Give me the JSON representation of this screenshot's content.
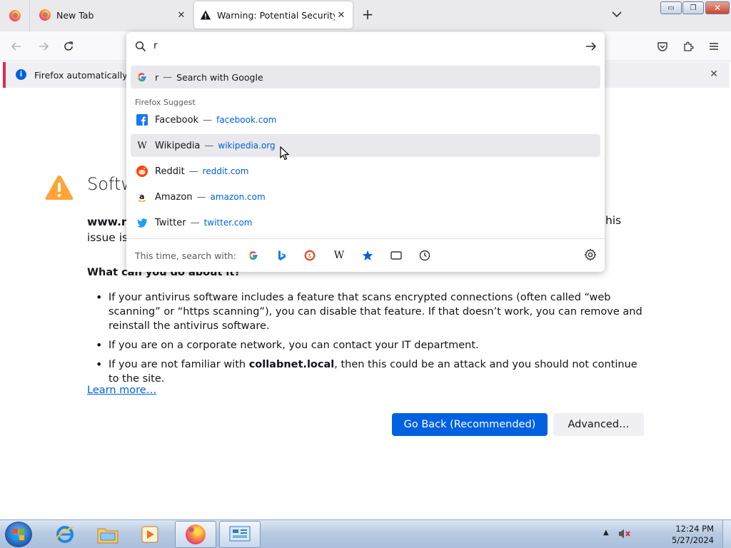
{
  "window": {
    "controls": {
      "minimize": "▭",
      "maximize": "❐",
      "close": "✕"
    }
  },
  "tabs": [
    {
      "title": "New Tab",
      "icon": "firefox-icon"
    },
    {
      "title": "Warning: Potential Security Risk",
      "icon": "warning-icon",
      "active": true
    }
  ],
  "tabbar": {
    "new_tab": "+",
    "close_glyph": "✕"
  },
  "notification": {
    "text": "Firefox automatically sen",
    "close": "✕"
  },
  "urlbar": {
    "input_value": "r",
    "top_suggestion": {
      "term": "r",
      "action": "Search with Google"
    },
    "group_label": "Firefox Suggest",
    "suggestions": [
      {
        "title": "Facebook",
        "url": "facebook.com",
        "icon": "facebook-icon"
      },
      {
        "title": "Wikipedia",
        "url": "wikipedia.org",
        "icon": "wikipedia-icon"
      },
      {
        "title": "Reddit",
        "url": "reddit.com",
        "icon": "reddit-icon"
      },
      {
        "title": "Amazon",
        "url": "amazon.com",
        "icon": "amazon-icon"
      },
      {
        "title": "Twitter",
        "url": "twitter.com",
        "icon": "twitter-icon"
      }
    ],
    "dash": "—",
    "oneoff_label": "This time, search with:",
    "oneoff_engines": [
      "google-icon",
      "bing-icon",
      "duckduckgo-icon",
      "wikipedia-icon",
      "bookmarks-icon",
      "tabs-icon",
      "history-icon"
    ]
  },
  "error_page": {
    "title": "Softw",
    "intro_host": "www.n",
    "intro_line2": "issue is",
    "intro_tail": "his",
    "heading": "What can you do about it?",
    "bullets": [
      {
        "text": "If your antivirus software includes a feature that scans encrypted connections (often called “web scanning” or “https scanning”), you can disable that feature. If that doesn’t work, you can remove and reinstall the antivirus software."
      },
      {
        "text": "If you are on a corporate network, you can contact your IT department."
      },
      {
        "pre": "If you are not familiar with ",
        "bold": "collabnet.local",
        "post": ", then this could be an attack and you should not continue to the site."
      }
    ],
    "learn_more": "Learn more…",
    "go_back_button": "Go Back (Recommended)",
    "advanced_button": "Advanced…"
  },
  "taskbar": {
    "time": "12:24 PM",
    "date": "5/27/2024",
    "tray_arrow": "▲"
  },
  "colors": {
    "accent": "#0061e0",
    "link": "#0060df",
    "warning": "#ffa436",
    "notice_border": "#e22850"
  }
}
